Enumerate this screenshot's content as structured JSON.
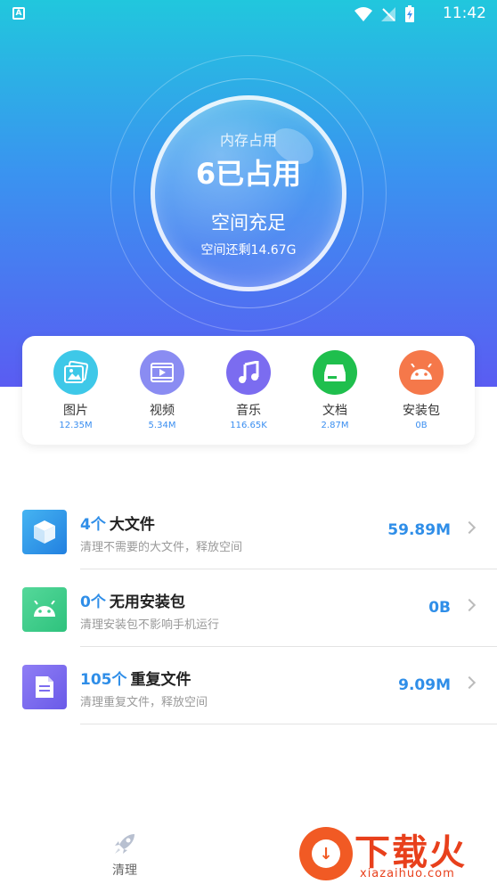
{
  "status_bar": {
    "app_badge": "A",
    "time": "11:42"
  },
  "memory": {
    "label": "内存占用",
    "used": "6已占用",
    "status": "空间充足",
    "remaining": "空间还剩14.67G"
  },
  "categories": [
    {
      "name": "图片",
      "size": "12.35M",
      "icon": "picture-icon",
      "color": "#3ec8e8"
    },
    {
      "name": "视频",
      "size": "5.34M",
      "icon": "video-icon",
      "color": "#8a8cf2"
    },
    {
      "name": "音乐",
      "size": "116.65K",
      "icon": "music-icon",
      "color": "#7b6cf0"
    },
    {
      "name": "文档",
      "size": "2.87M",
      "icon": "document-icon",
      "color": "#1fbf4d"
    },
    {
      "name": "安装包",
      "size": "0B",
      "icon": "android-icon",
      "color": "#f5784a"
    }
  ],
  "list": [
    {
      "count": "4个",
      "name": "大文件",
      "desc": "清理不需要的大文件，释放空间",
      "size": "59.89M",
      "icon": "cube-icon",
      "color": "#2f9be8"
    },
    {
      "count": "0个",
      "name": "无用安装包",
      "desc": "清理安装包不影响手机运行",
      "size": "0B",
      "icon": "android-icon",
      "color": "#3ccf8a"
    },
    {
      "count": "105个",
      "name": "重复文件",
      "desc": "清理重复文件，释放空间",
      "size": "9.09M",
      "icon": "file-icon",
      "color": "#7c6cf0"
    }
  ],
  "nav": {
    "clean_label": "清理"
  },
  "watermark": {
    "text": "下载火",
    "url": "xiazaihuo.com"
  }
}
